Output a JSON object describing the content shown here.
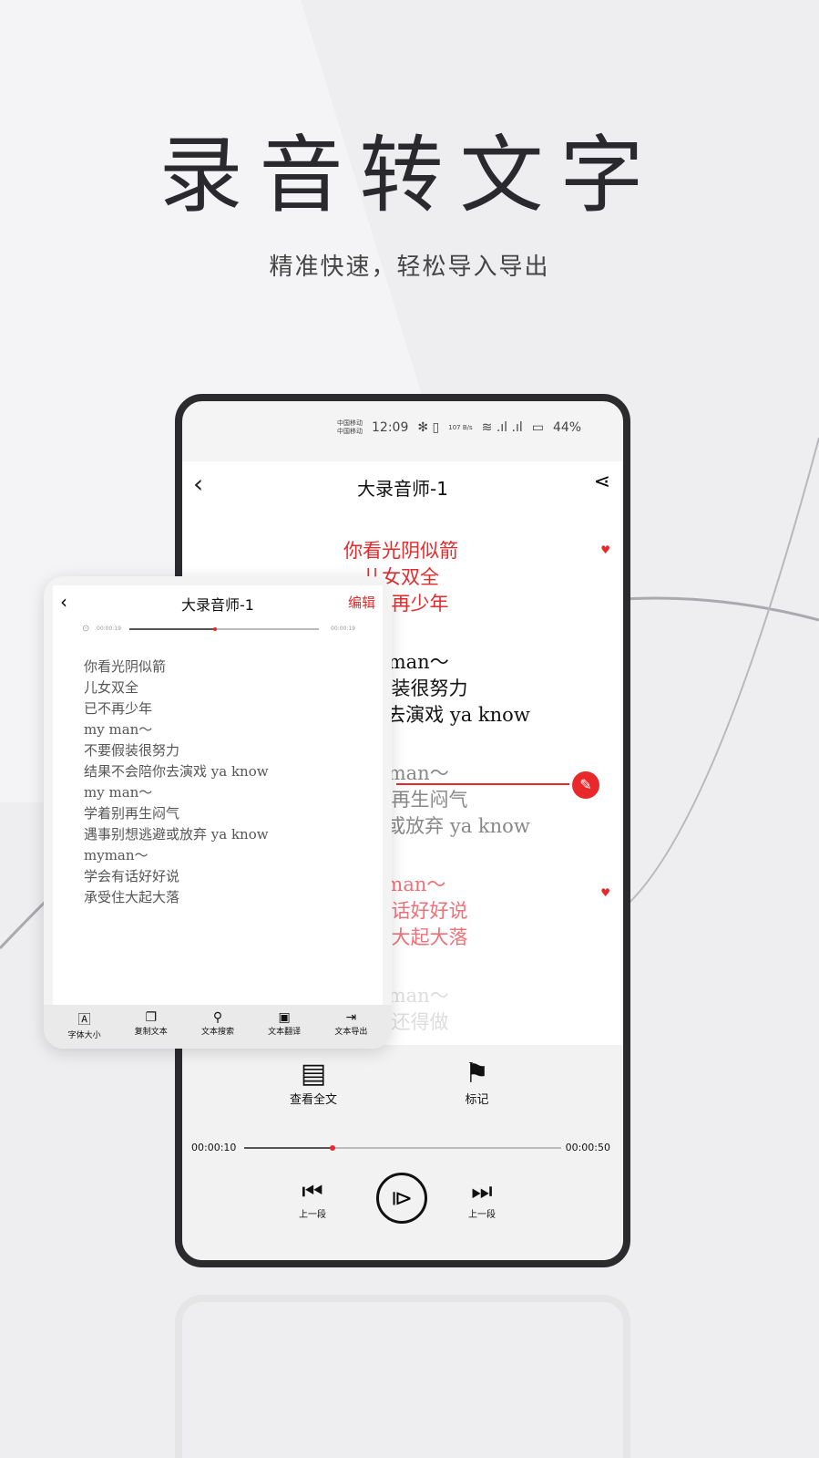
{
  "promo": {
    "headline": "录音转文字",
    "subtitle": "精准快速，轻松导入导出"
  },
  "status": {
    "carrier1": "中国移动",
    "carrier2": "中国移动",
    "time": "12:09",
    "speed": "107 B/s",
    "battery": "44%"
  },
  "phone": {
    "title": "大录音师-1",
    "lyric_groups": [
      {
        "style": "red",
        "lines": [
          "你看光阴似箭",
          "儿女双全",
          "已不再少年"
        ],
        "marked": true
      },
      {
        "style": "black",
        "lines": [
          "my man〜",
          "不要假装很努力",
          "结果不会陪你去演戏 ya know"
        ]
      },
      {
        "style": "gray",
        "lines": [
          "my man〜",
          "学着别再生闷气",
          "遇事别想逃避或放弃 ya know"
        ]
      },
      {
        "style": "pink",
        "lines": [
          "myman〜",
          "学会有话好好说",
          "承受住大起大落"
        ],
        "marked": true
      },
      {
        "style": "faint",
        "lines": [
          "my man〜",
          "怎么还得做"
        ]
      }
    ],
    "actions": {
      "full_text": "查看全文",
      "mark": "标记"
    },
    "time_current": "00:00:10",
    "time_total": "00:00:50",
    "progress": 0.28,
    "prev_label": "上一段",
    "next_label": "上一段"
  },
  "card": {
    "title": "大录音师-1",
    "edit": "编辑",
    "time_current": "00:00:19",
    "time_total": "00:00:19",
    "progress": 0.45,
    "lines": [
      "你看光阴似箭",
      "儿女双全",
      "已不再少年",
      "my man〜",
      "不要假装很努力",
      "结果不会陪你去演戏 ya know",
      "my man〜",
      "学着别再生闷气",
      "遇事别想逃避或放弃 ya know",
      "myman〜",
      "学会有话好好说",
      "承受住大起大落"
    ],
    "tools": [
      {
        "icon": "font-size-icon",
        "label": "字体大小"
      },
      {
        "icon": "copy-icon",
        "label": "复制文本"
      },
      {
        "icon": "search-icon",
        "label": "文本搜索"
      },
      {
        "icon": "translate-icon",
        "label": "文本翻译"
      },
      {
        "icon": "export-icon",
        "label": "文本导出"
      }
    ]
  },
  "colors": {
    "accent": "#e8282b"
  }
}
